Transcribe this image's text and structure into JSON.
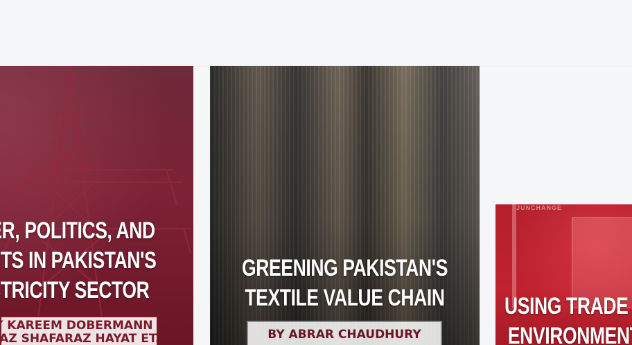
{
  "articles": [
    {
      "title_lines": [
        "Power, Politics, and",
        "Profits in Pakistan's",
        "Electricity Sector"
      ],
      "byline_lines": [
        "By Kareem Dobermann and",
        "Fiaz Shafaraz Hayat et. al."
      ],
      "image": "transmission-tower",
      "accent_color": "#7b1a28"
    },
    {
      "title_lines": [
        "Greening Pakistan's",
        "Textile Value Chain"
      ],
      "byline": "By Abrar Chaudhury",
      "image": "textile-loom",
      "accent_color": "#6b1424"
    },
    {
      "title_lines": [
        "Using Trade for",
        "Environmental"
      ],
      "image": "shipping-container",
      "image_text": "JUNCHANGE",
      "accent_color": "#c0222f"
    }
  ]
}
